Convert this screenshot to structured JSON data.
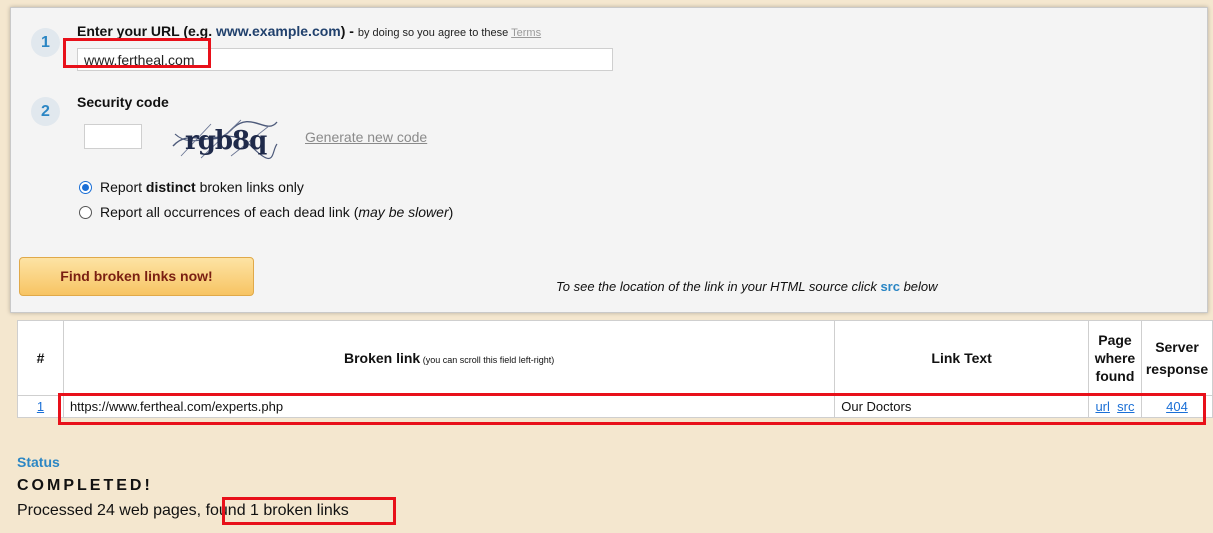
{
  "form": {
    "step1_number": "1",
    "url_label": "Enter your URL (e.g. ",
    "url_example": "www.example.com",
    "url_label_end": ") - ",
    "agree_text": "by doing so you agree to these ",
    "terms_link": "Terms",
    "url_value": "www.fertheal.com",
    "step2_number": "2",
    "security_label": "Security code",
    "captcha_text": "rgb8q",
    "generate_link": "Generate new code",
    "radio_distinct_pre": "Report ",
    "radio_distinct_bold": "distinct",
    "radio_distinct_post": " broken links only",
    "radio_distinct_checked": true,
    "radio_all_pre": "Report all occurrences of each dead link (",
    "radio_all_italic": "may be slower",
    "radio_all_post": ")",
    "find_button": "Find broken links now!",
    "hint_pre": "To see the location of the link in your HTML source click ",
    "hint_src": "src",
    "hint_post": " below"
  },
  "table": {
    "headers": {
      "num": "#",
      "link": "Broken link",
      "link_note": " (you can scroll this field left-right)",
      "link_text": "Link Text",
      "page_where_found": [
        "Page",
        "where",
        "found"
      ],
      "server_response": [
        "Server",
        "response"
      ]
    },
    "rows": [
      {
        "num": "1",
        "url": "https://www.fertheal.com/experts.php",
        "text": "Our Doctors",
        "page_url": "url",
        "page_src": "src",
        "response": "404"
      }
    ]
  },
  "status": {
    "heading": "Status",
    "value": "COMPLETED!",
    "detail_pre": "Processed 24 web pages, ",
    "detail_found": "found 1 broken links"
  },
  "colors": {
    "accent_blue": "#2b86c4",
    "highlight_red": "#e8101a",
    "button_text": "#7a1f12"
  }
}
